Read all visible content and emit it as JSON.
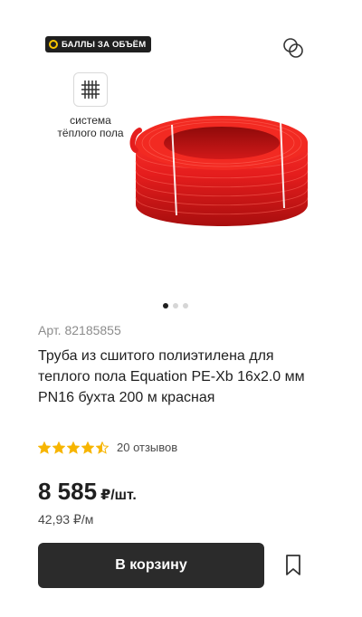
{
  "promo": {
    "label": "БАЛЛЫ ЗА ОБЪЁМ",
    "coin_color": "#f5c400"
  },
  "feature": {
    "icon": "heated-floor-grid-icon",
    "label_line1": "система",
    "label_line2": "тёплого пола"
  },
  "gallery": {
    "slide_count": 3,
    "active_index": 0,
    "product_color": "#e51d1d"
  },
  "product": {
    "sku": "Арт. 82185855",
    "title": "Труба из сшитого полиэтилена для теплого пола Equation PE-Xb 16x2.0 мм PN16 бухта 200 м красная",
    "rating": 4.5,
    "rating_max": 5,
    "star_color": "#f7b500",
    "reviews": "20 отзывов"
  },
  "pricing": {
    "price": "8 585",
    "price_unit": "₽/шт.",
    "unit_price": "42,93 ₽/м"
  },
  "actions": {
    "add_to_cart": "В корзину",
    "compare_icon": "compare-icon",
    "favorite_icon": "bookmark-icon"
  }
}
